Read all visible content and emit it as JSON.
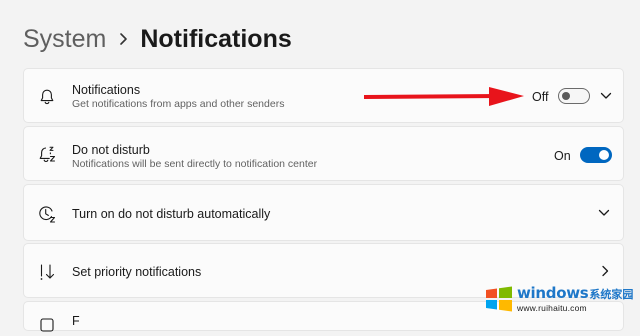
{
  "breadcrumb": {
    "parent": "System",
    "current": "Notifications"
  },
  "settings": [
    {
      "title": "Notifications",
      "subtitle": "Get notifications from apps and other senders",
      "state": "Off",
      "icon": "bell-icon",
      "control": "toggle-off",
      "expander": "chevron-down-icon"
    },
    {
      "title": "Do not disturb",
      "subtitle": "Notifications will be sent directly to notification center",
      "state": "On",
      "icon": "bell-snooze-icon",
      "control": "toggle-on"
    },
    {
      "title": "Turn on do not disturb automatically",
      "icon": "clock-snooze-icon",
      "expander": "chevron-down-icon"
    },
    {
      "title": "Set priority notifications",
      "icon": "priority-sort-icon",
      "expander": "chevron-right-icon"
    },
    {
      "title": "F",
      "icon": "partial-icon"
    }
  ],
  "colors": {
    "accent": "#0067c0",
    "annotation_arrow": "#e8141b",
    "page_background": "#f3f3f3",
    "card_background": "#fbfbfb"
  },
  "watermark": {
    "brand": "windows",
    "brand_cn": "系统家园",
    "url": "www.ruihaitu.com"
  }
}
